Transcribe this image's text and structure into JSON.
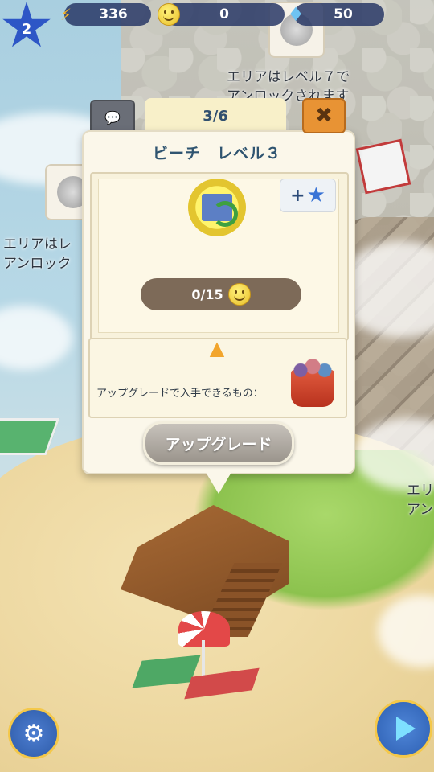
{
  "hud": {
    "level": "2",
    "energy": "336",
    "smiles": "0",
    "gems": "50"
  },
  "map_labels": {
    "area_top_right_line1": "エリアはレベル７で",
    "area_top_right_line2": "アンロックされます",
    "area_left_line1": "エリアはレ",
    "area_left_line2": "アンロック",
    "area_right_line1": "エリ",
    "area_right_line2": "アン"
  },
  "popup": {
    "page": "3/6",
    "title": "ビーチ　レベル３",
    "close_symbol": "✖",
    "plus_symbol": "+",
    "progress": "0/15",
    "rewards_label": "アップグレードで入手できるもの：",
    "upgrade_button": "アップグレード"
  },
  "icons": {
    "chat": "chat-bubble-icon",
    "close": "close-icon",
    "energy": "lightning-icon",
    "smile": "smile-icon",
    "gem": "diamond-icon",
    "settings": "gear-icon",
    "play": "play-icon"
  },
  "colors": {
    "hud_pill": "#293866",
    "popup_bg": "#fbf7ea",
    "close_btn": "#e89334",
    "progress_bar": "#7d6a58",
    "upgrade_btn": "#b1aca4"
  }
}
